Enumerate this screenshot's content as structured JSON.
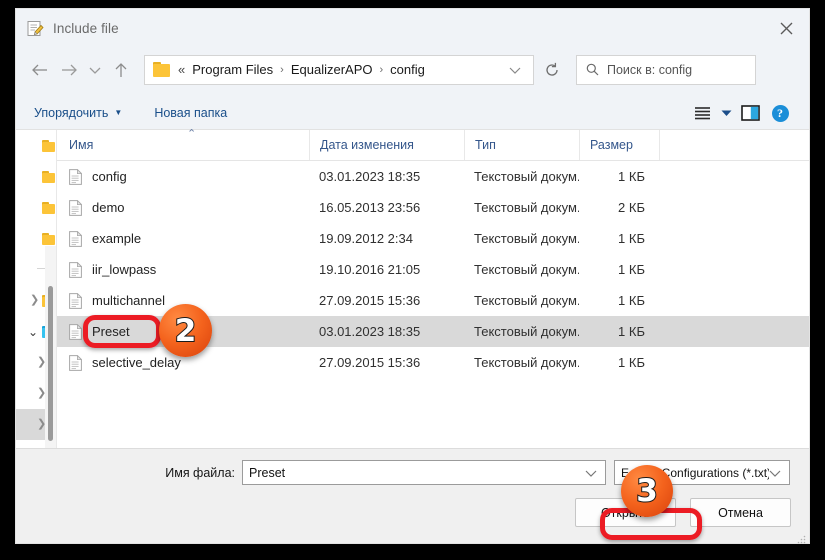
{
  "window": {
    "title": "Include file",
    "title_icon": "notepad-pencil-icon",
    "close_label": "✕"
  },
  "navigation": {
    "back_icon": "arrow-left-icon",
    "forward_icon": "arrow-right-icon",
    "recent_icon": "chevron-down-icon",
    "up_icon": "arrow-up-icon",
    "refresh_icon": "refresh-icon"
  },
  "address_bar": {
    "folder_icon": "folder-icon",
    "prefix": "«",
    "crumbs": [
      "Program Files",
      "EqualizerAPO",
      "config"
    ],
    "separator": "›",
    "dropdown_icon": "chevron-down-icon"
  },
  "search": {
    "icon": "search-icon",
    "placeholder": "Поиск в: config"
  },
  "toolbar": {
    "organize_label": "Упорядочить",
    "organize_caret": "▼",
    "new_folder_label": "Новая папка",
    "view_icon": "list-view-icon",
    "view_caret": "▼",
    "preview_pane_icon": "preview-pane-icon",
    "help_icon": "help-icon",
    "help_label": "?"
  },
  "columns": {
    "name": "Имя",
    "date": "Дата изменения",
    "type": "Тип",
    "size": "Размер",
    "sort_caret": "⌃"
  },
  "files": [
    {
      "name": "config",
      "date": "03.01.2023 18:35",
      "type": "Текстовый докум...",
      "size": "1 КБ",
      "selected": false
    },
    {
      "name": "demo",
      "date": "16.05.2013 23:56",
      "type": "Текстовый докум...",
      "size": "2 КБ",
      "selected": false
    },
    {
      "name": "example",
      "date": "19.09.2012 2:34",
      "type": "Текстовый докум...",
      "size": "1 КБ",
      "selected": false
    },
    {
      "name": "iir_lowpass",
      "date": "19.10.2016 21:05",
      "type": "Текстовый докум...",
      "size": "1 КБ",
      "selected": false
    },
    {
      "name": "multichannel",
      "date": "27.09.2015 15:36",
      "type": "Текстовый докум...",
      "size": "1 КБ",
      "selected": false
    },
    {
      "name": "Preset",
      "date": "03.01.2023 18:35",
      "type": "Текстовый докум...",
      "size": "1 КБ",
      "selected": true
    },
    {
      "name": "selective_delay",
      "date": "27.09.2015 15:36",
      "type": "Текстовый докум...",
      "size": "1 КБ",
      "selected": false
    }
  ],
  "footer": {
    "file_name_label": "Имя файла:",
    "file_name_value": "Preset",
    "file_name_caret": "⌄",
    "file_type_value": "E-APO Configurations (*.txt)",
    "file_type_caret": "⌄",
    "open_label": "Открыть",
    "cancel_label": "Отмена"
  },
  "annotations": {
    "badge_2": "2",
    "badge_3": "3",
    "highlight_color": "#ec1c24",
    "badge_color": "#f4631d"
  }
}
